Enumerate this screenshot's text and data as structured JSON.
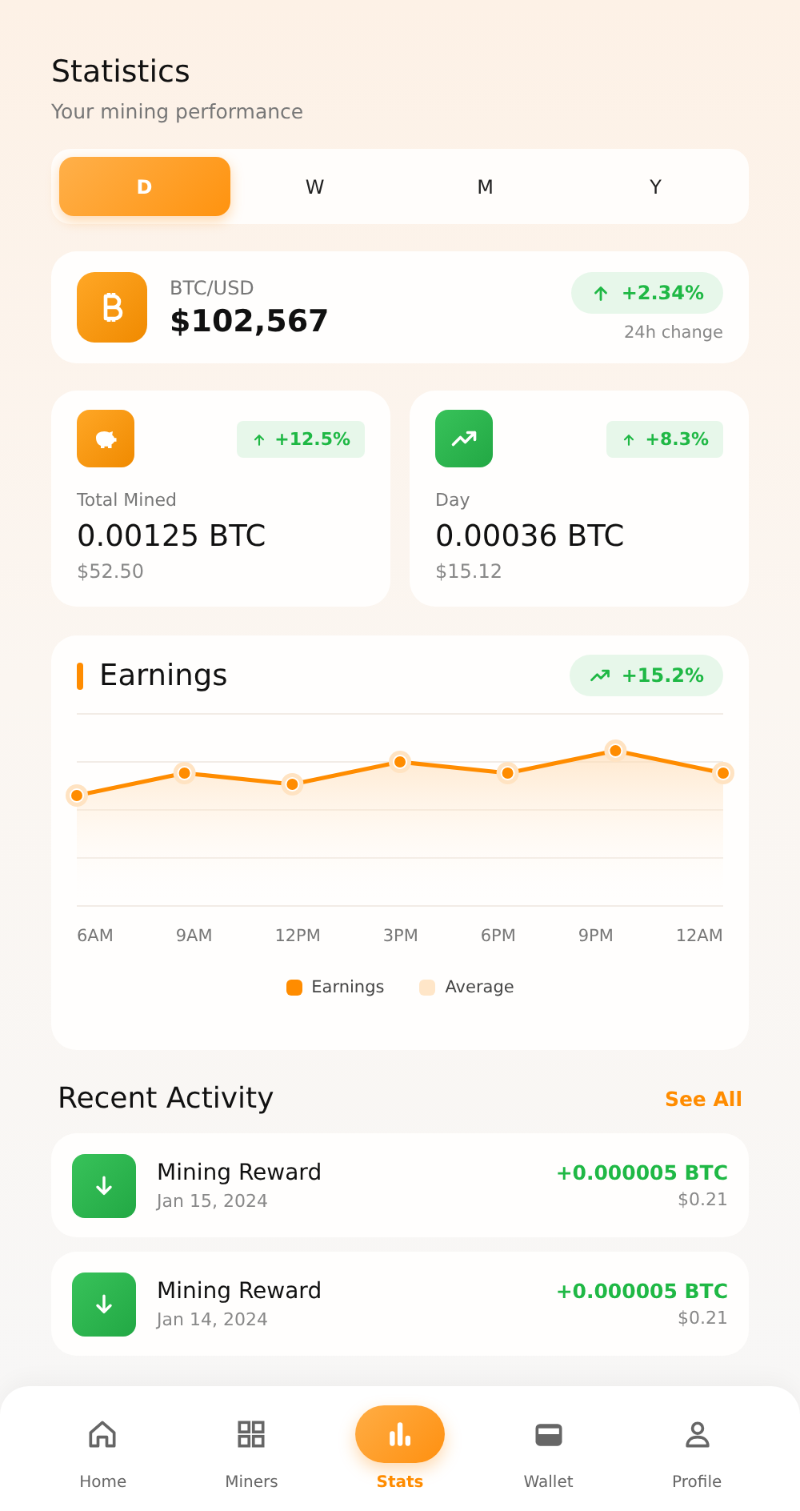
{
  "header": {
    "title": "Statistics",
    "subtitle": "Your mining performance"
  },
  "periods": [
    {
      "label": "D",
      "selected": true
    },
    {
      "label": "W",
      "selected": false
    },
    {
      "label": "M",
      "selected": false
    },
    {
      "label": "Y",
      "selected": false
    }
  ],
  "price": {
    "pair": "BTC/USD",
    "value": "$102,567",
    "change": "+2.34%",
    "change_label": "24h change"
  },
  "stats": [
    {
      "kind": "piggy",
      "label": "Total Mined",
      "value": "0.00125 BTC",
      "usd": "$52.50",
      "change": "+12.5%"
    },
    {
      "kind": "trend",
      "label": "Day",
      "value": "0.00036 BTC",
      "usd": "$15.12",
      "change": "+8.3%"
    }
  ],
  "earnings": {
    "title": "Earnings",
    "change": "+15.2%",
    "x_labels": [
      "6AM",
      "9AM",
      "12PM",
      "3PM",
      "6PM",
      "9PM",
      "12AM"
    ],
    "legend": [
      {
        "label": "Earnings",
        "color": "#ff8c00"
      },
      {
        "label": "Average",
        "color": "#ffe6c8"
      }
    ]
  },
  "activity": {
    "title": "Recent Activity",
    "link": "See All",
    "items": [
      {
        "title": "Mining Reward",
        "date": "Jan 15, 2024",
        "amount": "+0.000005 BTC",
        "usd": "$0.21"
      },
      {
        "title": "Mining Reward",
        "date": "Jan 14, 2024",
        "amount": "+0.000005 BTC",
        "usd": "$0.21"
      }
    ]
  },
  "nav": [
    {
      "kind": "home",
      "label": "Home",
      "selected": false
    },
    {
      "kind": "grid",
      "label": "Miners",
      "selected": false
    },
    {
      "kind": "chart",
      "label": "Stats",
      "selected": true
    },
    {
      "kind": "wallet",
      "label": "Wallet",
      "selected": false
    },
    {
      "kind": "person",
      "label": "Profile",
      "selected": false
    }
  ]
}
